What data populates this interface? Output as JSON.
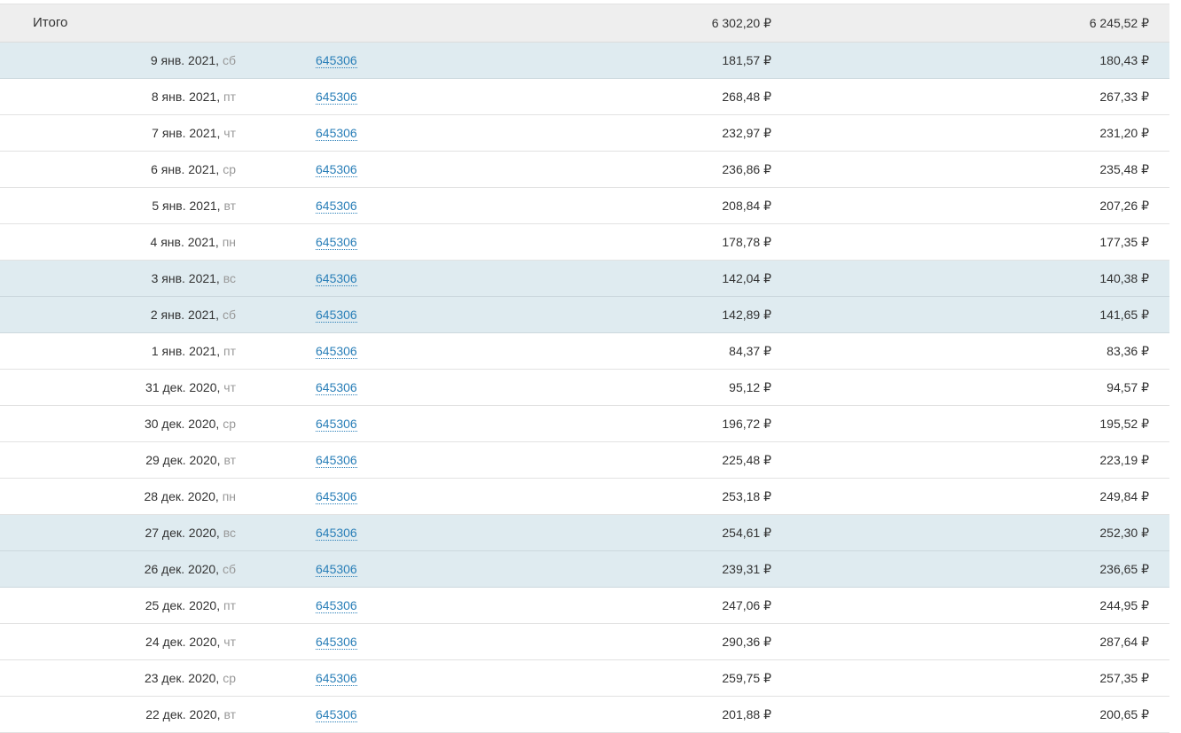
{
  "total": {
    "label": "Итого",
    "amount1": "6 302,20 ₽",
    "amount2": "6 245,52 ₽"
  },
  "rows": [
    {
      "date": "9 янв. 2021,",
      "dow": "сб",
      "id": "645306",
      "amount1": "181,57 ₽",
      "amount2": "180,43 ₽",
      "weekend": true
    },
    {
      "date": "8 янв. 2021,",
      "dow": "пт",
      "id": "645306",
      "amount1": "268,48 ₽",
      "amount2": "267,33 ₽",
      "weekend": false
    },
    {
      "date": "7 янв. 2021,",
      "dow": "чт",
      "id": "645306",
      "amount1": "232,97 ₽",
      "amount2": "231,20 ₽",
      "weekend": false
    },
    {
      "date": "6 янв. 2021,",
      "dow": "ср",
      "id": "645306",
      "amount1": "236,86 ₽",
      "amount2": "235,48 ₽",
      "weekend": false
    },
    {
      "date": "5 янв. 2021,",
      "dow": "вт",
      "id": "645306",
      "amount1": "208,84 ₽",
      "amount2": "207,26 ₽",
      "weekend": false
    },
    {
      "date": "4 янв. 2021,",
      "dow": "пн",
      "id": "645306",
      "amount1": "178,78 ₽",
      "amount2": "177,35 ₽",
      "weekend": false
    },
    {
      "date": "3 янв. 2021,",
      "dow": "вс",
      "id": "645306",
      "amount1": "142,04 ₽",
      "amount2": "140,38 ₽",
      "weekend": true
    },
    {
      "date": "2 янв. 2021,",
      "dow": "сб",
      "id": "645306",
      "amount1": "142,89 ₽",
      "amount2": "141,65 ₽",
      "weekend": true
    },
    {
      "date": "1 янв. 2021,",
      "dow": "пт",
      "id": "645306",
      "amount1": "84,37 ₽",
      "amount2": "83,36 ₽",
      "weekend": false
    },
    {
      "date": "31 дек. 2020,",
      "dow": "чт",
      "id": "645306",
      "amount1": "95,12 ₽",
      "amount2": "94,57 ₽",
      "weekend": false
    },
    {
      "date": "30 дек. 2020,",
      "dow": "ср",
      "id": "645306",
      "amount1": "196,72 ₽",
      "amount2": "195,52 ₽",
      "weekend": false
    },
    {
      "date": "29 дек. 2020,",
      "dow": "вт",
      "id": "645306",
      "amount1": "225,48 ₽",
      "amount2": "223,19 ₽",
      "weekend": false
    },
    {
      "date": "28 дек. 2020,",
      "dow": "пн",
      "id": "645306",
      "amount1": "253,18 ₽",
      "amount2": "249,84 ₽",
      "weekend": false
    },
    {
      "date": "27 дек. 2020,",
      "dow": "вс",
      "id": "645306",
      "amount1": "254,61 ₽",
      "amount2": "252,30 ₽",
      "weekend": true
    },
    {
      "date": "26 дек. 2020,",
      "dow": "сб",
      "id": "645306",
      "amount1": "239,31 ₽",
      "amount2": "236,65 ₽",
      "weekend": true
    },
    {
      "date": "25 дек. 2020,",
      "dow": "пт",
      "id": "645306",
      "amount1": "247,06 ₽",
      "amount2": "244,95 ₽",
      "weekend": false
    },
    {
      "date": "24 дек. 2020,",
      "dow": "чт",
      "id": "645306",
      "amount1": "290,36 ₽",
      "amount2": "287,64 ₽",
      "weekend": false
    },
    {
      "date": "23 дек. 2020,",
      "dow": "ср",
      "id": "645306",
      "amount1": "259,75 ₽",
      "amount2": "257,35 ₽",
      "weekend": false
    },
    {
      "date": "22 дек. 2020,",
      "dow": "вт",
      "id": "645306",
      "amount1": "201,88 ₽",
      "amount2": "200,65 ₽",
      "weekend": false
    }
  ]
}
